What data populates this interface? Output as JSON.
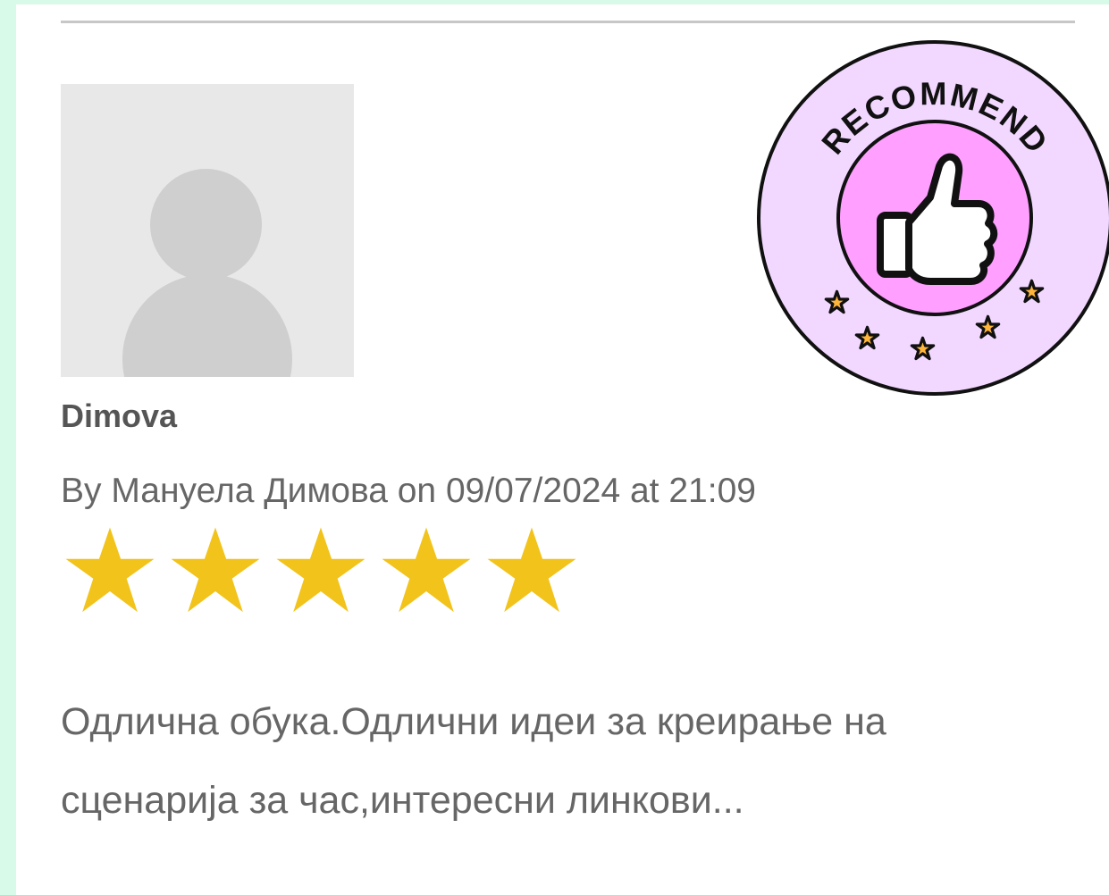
{
  "review": {
    "author_name": "Dimova",
    "meta": "By Мануела Димова on 09/07/2024 at 21:09",
    "rating": 5,
    "max_rating": 5,
    "text_line_1": "Одлична обука.Одлични идеи за креирање на",
    "text_line_2": "сценарија за час,интересни линкови..."
  },
  "badge": {
    "label": "RECOMMEND",
    "icon": "thumbs-up-icon",
    "stars": 5
  },
  "colors": {
    "frame": "#d7fbe8",
    "card": "#ffffff",
    "divider": "#c7c7c7",
    "avatar_bg": "#e8e8e8",
    "avatar_fg": "#cfcfcf",
    "review_text": "#666666",
    "star_fill": "#f2c31b",
    "badge_outer": "#f2d8ff",
    "badge_inner": "#ff9fff",
    "badge_star": "#ffb53a"
  }
}
